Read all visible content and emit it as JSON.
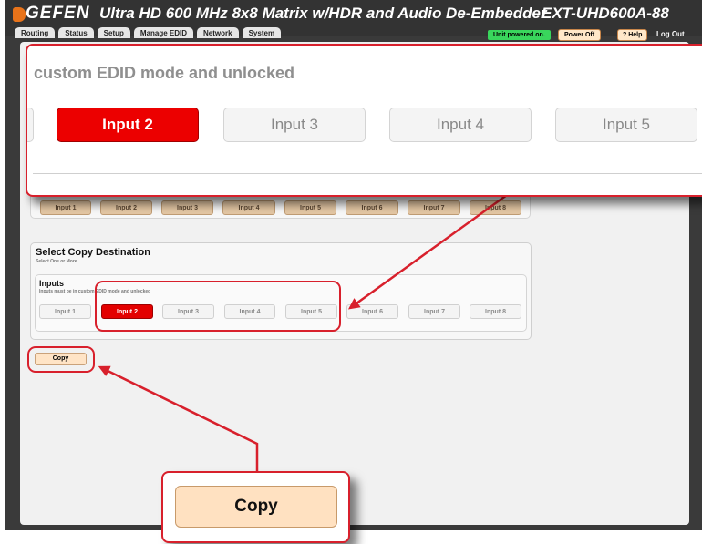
{
  "header": {
    "logo_text": "GEFEN",
    "title": "Ultra HD 600 MHz 8x8 Matrix w/HDR and Audio De-Embedder",
    "model": "EXT-UHD600A-88",
    "tabs": [
      "Routing",
      "Status",
      "Setup",
      "Manage EDID",
      "Network",
      "System"
    ],
    "status_text": "Unit powered on.",
    "power_label": "Power Off",
    "help_label": "? Help",
    "logout_label": "Log Out",
    "status_color": "#39d65c"
  },
  "source_inputs": [
    "Input 1",
    "Input 2",
    "Input 3",
    "Input 4",
    "Input 5",
    "Input 6",
    "Input 7",
    "Input 8"
  ],
  "destination": {
    "title": "Select Copy Destination",
    "subtitle": "Select One or More",
    "inputs_title": "Inputs",
    "inputs_note": "Inputs must be in custom EDID mode and unlocked",
    "inputs": [
      "Input 1",
      "Input 2",
      "Input 3",
      "Input 4",
      "Input 5",
      "Input 6",
      "Input 7",
      "Input 8"
    ],
    "selected": "Input 2"
  },
  "copy_label": "Copy",
  "zoom": {
    "note_fragment": "custom EDID mode and unlocked",
    "buttons": [
      "Input 2",
      "Input 3",
      "Input 4",
      "Input 5"
    ],
    "selected": "Input 2",
    "copy_label": "Copy"
  },
  "colors": {
    "selected": "#e30000",
    "callout": "#d8202c",
    "copy_button": "#ffe4c6",
    "source_button": "#e3c6a3"
  }
}
